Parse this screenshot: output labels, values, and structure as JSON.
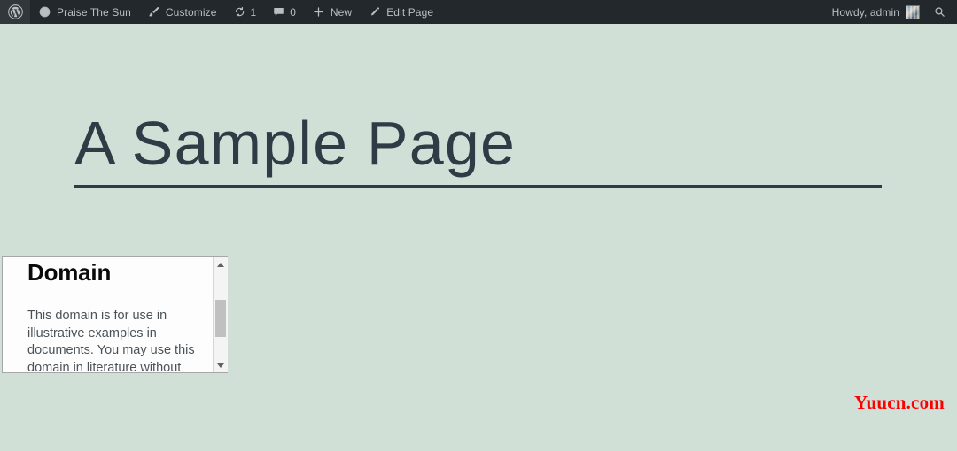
{
  "colors": {
    "page_background": "#d1e0d7",
    "adminbar_background": "#23282d",
    "adminbar_text": "#b9bfc4",
    "title_text": "#2f3b45",
    "rule": "#2f3b45",
    "watermark": "#ff0000",
    "embed_background": "#ffffff",
    "embed_border": "#a7a7a7",
    "scrollbar_thumb": "#c0c0c0"
  },
  "adminbar": {
    "left_items": [
      {
        "id": "wp-logo",
        "icon": "wordpress-logo-icon",
        "label": ""
      },
      {
        "id": "site-name",
        "icon": "dashboard-home-icon",
        "label": "Praise The Sun"
      },
      {
        "id": "customize",
        "icon": "paintbrush-icon",
        "label": "Customize"
      },
      {
        "id": "updates",
        "icon": "update-arrows-icon",
        "label": "1"
      },
      {
        "id": "comments",
        "icon": "comment-bubble-icon",
        "label": "0"
      },
      {
        "id": "new-content",
        "icon": "plus-icon",
        "label": "New"
      },
      {
        "id": "edit-page",
        "icon": "pencil-icon",
        "label": "Edit Page"
      }
    ],
    "right_items": [
      {
        "id": "my-account",
        "icon": "avatar-icon",
        "label": "Howdy, admin"
      },
      {
        "id": "search",
        "icon": "search-icon",
        "label": ""
      }
    ]
  },
  "main": {
    "page_title": "A Sample Page"
  },
  "embed": {
    "heading": "Domain",
    "body": "This domain is for use in illustrative examples in documents. You may use this domain in literature without prior coordination or asking",
    "scrollbar": {
      "up_arrow": "scroll-up-arrow-icon",
      "down_arrow": "scroll-down-arrow-icon"
    }
  },
  "watermark": {
    "text": "Yuucn.com"
  }
}
